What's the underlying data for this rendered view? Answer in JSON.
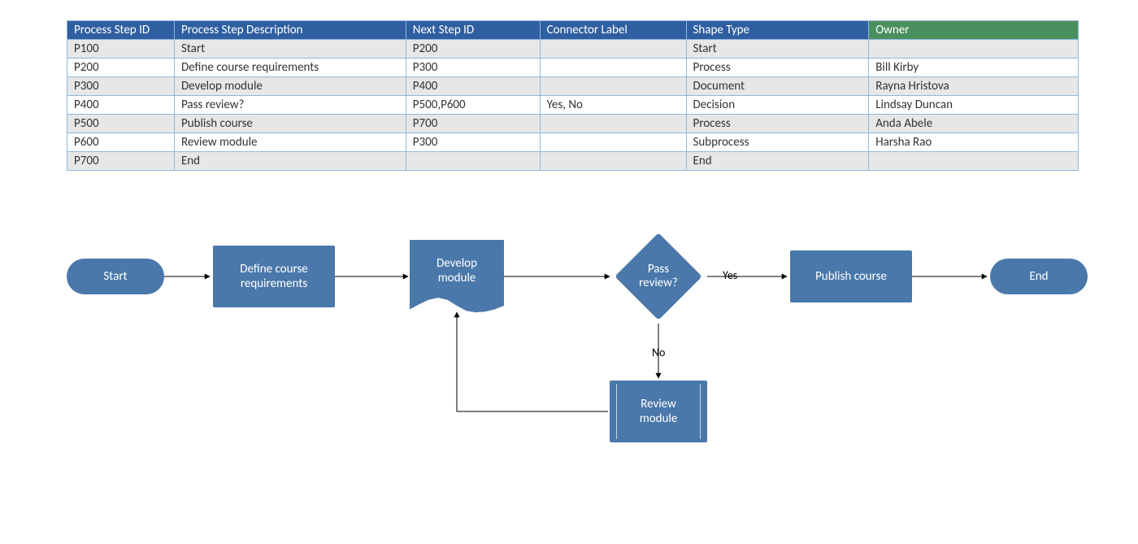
{
  "table": {
    "headers": {
      "step_id": "Process Step ID",
      "description": "Process Step Description",
      "next_id": "Next Step ID",
      "connector": "Connector Label",
      "shape": "Shape Type",
      "owner": "Owner"
    },
    "rows": [
      {
        "id": "P100",
        "desc": "Start",
        "next": "P200",
        "conn": "",
        "shape": "Start",
        "owner": ""
      },
      {
        "id": "P200",
        "desc": "Define course requirements",
        "next": "P300",
        "conn": "",
        "shape": "Process",
        "owner": "Bill Kirby"
      },
      {
        "id": "P300",
        "desc": "Develop module",
        "next": "P400",
        "conn": "",
        "shape": "Document",
        "owner": "Rayna Hristova"
      },
      {
        "id": "P400",
        "desc": "Pass review?",
        "next": "P500,P600",
        "conn": "Yes, No",
        "shape": "Decision",
        "owner": "Lindsay Duncan"
      },
      {
        "id": "P500",
        "desc": "Publish course",
        "next": "P700",
        "conn": "",
        "shape": "Process",
        "owner": "Anda Abele"
      },
      {
        "id": "P600",
        "desc": "Review module",
        "next": "P300",
        "conn": "",
        "shape": "Subprocess",
        "owner": "Harsha Rao"
      },
      {
        "id": "P700",
        "desc": "End",
        "next": "",
        "conn": "",
        "shape": "End",
        "owner": ""
      }
    ]
  },
  "flowchart": {
    "nodes": {
      "start": "Start",
      "define": "Define course\nrequirements",
      "develop": "Develop\nmodule",
      "decision": "Pass\nreview?",
      "publish": "Publish course",
      "review": "Review\nmodule",
      "end": "End"
    },
    "edge_labels": {
      "yes": "Yes",
      "no": "No"
    }
  }
}
